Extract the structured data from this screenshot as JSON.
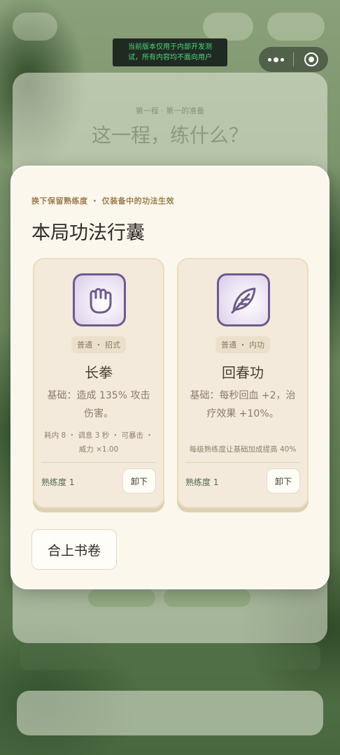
{
  "dev_banner": {
    "line1": "当前版本仅用于内部开发测",
    "line2": "试，所有内容均不面向用户"
  },
  "capsule": {
    "more_icon": "more-dots-icon",
    "close_icon": "target-circle-icon"
  },
  "background": {
    "subtitle": "第一程 · 第一的准备",
    "title": "这一程，练什么？"
  },
  "modal": {
    "subtitle": "换下保留熟练度 ・ 仅装备中的功法生效",
    "title": "本局功法行囊",
    "close_button": "合上书卷",
    "cards": [
      {
        "icon": "fist-icon",
        "tag": "普通 ・ 招式",
        "name": "长拳",
        "desc": "基础：造成 135% 攻击伤害。",
        "meta_line1": "耗内 8 ・ 调息 3 秒 ・ 可暴击 ・",
        "meta_line2": "威力 ×1.00",
        "proficiency": "熟练度 1",
        "button": "卸下"
      },
      {
        "icon": "leaf-feather-icon",
        "tag": "普通 ・ 内功",
        "name": "回春功",
        "desc": "基础：每秒回血 +2，治疗效果 +10%。",
        "meta_line1": "每级熟练度让基础加成提高 40%",
        "proficiency": "熟练度 1",
        "button": "卸下"
      }
    ]
  },
  "colors": {
    "modal_bg": "#fcf7ec",
    "card_bg": "#f4eadb",
    "icon_border": "#6d5b8c",
    "subtitle": "#9a7e4e",
    "proficiency": "#4d6a4d",
    "dev_text": "#4fd67a"
  }
}
